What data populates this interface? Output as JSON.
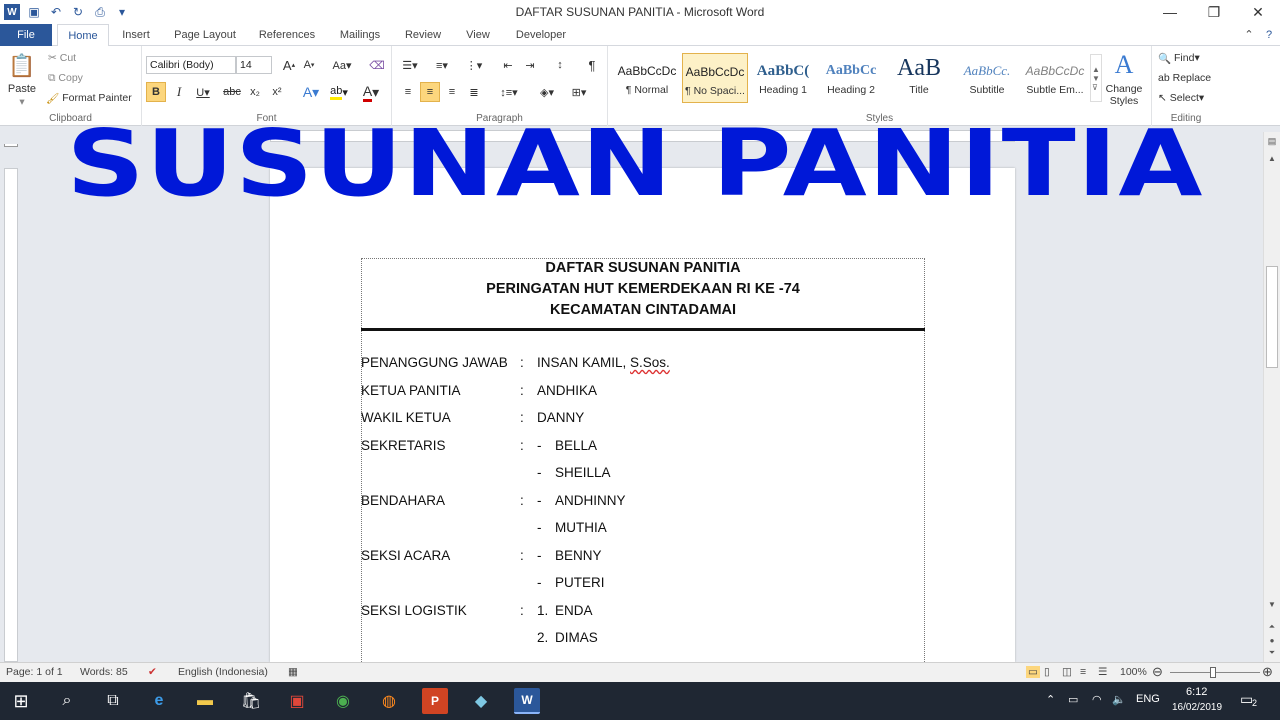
{
  "window": {
    "title": "DAFTAR SUSUNAN PANITIA  -  Microsoft Word",
    "controls": {
      "minimize": "—",
      "restore": "❐",
      "close": "✕"
    }
  },
  "qat": {
    "icons": [
      "word-icon",
      "save-icon",
      "undo-icon",
      "redo-icon",
      "print-preview-icon",
      "customize-icon"
    ]
  },
  "tabs": [
    {
      "label": "File"
    },
    {
      "label": "Home"
    },
    {
      "label": "Insert"
    },
    {
      "label": "Page Layout"
    },
    {
      "label": "References"
    },
    {
      "label": "Mailings"
    },
    {
      "label": "Review"
    },
    {
      "label": "View"
    },
    {
      "label": "Developer"
    }
  ],
  "ribbon": {
    "clipboard": {
      "label": "Clipboard",
      "paste": "Paste",
      "cut": "Cut",
      "copy": "Copy",
      "format_painter": "Format Painter"
    },
    "font": {
      "label": "Font",
      "font_name": "Calibri (Body)",
      "font_size": "14"
    },
    "paragraph": {
      "label": "Paragraph"
    },
    "styles": {
      "label": "Styles",
      "items": [
        {
          "sample": "AaBbCcDc",
          "name": "¶ Normal"
        },
        {
          "sample": "AaBbCcDc",
          "name": "¶ No Spaci..."
        },
        {
          "sample": "AaBbC(",
          "name": "Heading 1"
        },
        {
          "sample": "AaBbCc",
          "name": "Heading 2"
        },
        {
          "sample": "AaB",
          "name": "Title"
        },
        {
          "sample": "AaBbCc.",
          "name": "Subtitle"
        },
        {
          "sample": "AaBbCcDc",
          "name": "Subtle Em..."
        }
      ],
      "change_styles": "Change Styles"
    },
    "editing": {
      "label": "Editing",
      "find": "Find",
      "replace": "Replace",
      "select": "Select"
    }
  },
  "banner": {
    "text": "SUSUNAN PANITIA",
    "color": "#0018d8"
  },
  "document": {
    "heading": [
      "DAFTAR SUSUNAN PANITIA",
      "PERINGATAN HUT KEMERDEKAAN RI KE -74",
      "KECAMATAN CINTADAMAI"
    ],
    "rows": [
      {
        "label": "PENANGGUNG JAWAB",
        "colon": ":",
        "marker": "",
        "value": "INSAN KAMIL, ",
        "value2": "S.Sos."
      },
      {
        "label": "KETUA PANITIA",
        "colon": ":",
        "marker": "",
        "value": "ANDHIKA"
      },
      {
        "label": "WAKIL KETUA",
        "colon": ":",
        "marker": "",
        "value": "DANNY"
      },
      {
        "label": "SEKRETARIS",
        "colon": ":",
        "marker": "-",
        "value": "BELLA"
      },
      {
        "label": "",
        "colon": "",
        "marker": "-",
        "value": "SHEILLA"
      },
      {
        "label": "BENDAHARA",
        "colon": ":",
        "marker": "-",
        "value": "ANDHINNY"
      },
      {
        "label": "",
        "colon": "",
        "marker": "-",
        "value": "MUTHIA"
      },
      {
        "label": "SEKSI ACARA",
        "colon": ":",
        "marker": "-",
        "value": "BENNY"
      },
      {
        "label": "",
        "colon": "",
        "marker": "-",
        "value": "PUTERI"
      },
      {
        "label": "SEKSI LOGISTIK",
        "colon": ":",
        "marker": "1.",
        "value": "ENDA"
      },
      {
        "label": "",
        "colon": "",
        "marker": "2.",
        "value": "DIMAS"
      }
    ]
  },
  "status": {
    "page": "Page: 1 of 1",
    "words": "Words: 85",
    "language": "English (Indonesia)",
    "zoom": "100%"
  },
  "taskbar": {
    "lang": "ENG",
    "time": "6:12",
    "date": "16/02/2019",
    "notifications": "2"
  }
}
